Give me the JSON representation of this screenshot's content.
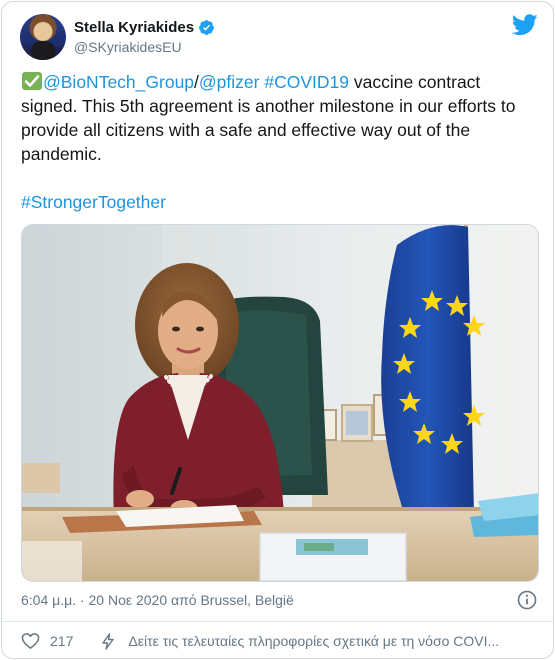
{
  "author": {
    "name": "Stella Kyriakides",
    "handle": "@SKyriakidesEU",
    "verified": true
  },
  "tweet": {
    "check_emoji": "✅",
    "mention_biontech": "@BioNTech_Group",
    "slash": "/",
    "mention_pfizer": "@pfizer",
    "space": " ",
    "hashtag_covid": "#COVID19",
    "body": " vaccine contract signed. This 5th agreement is another milestone in our efforts to provide all citizens with a safe and effective way out of the pandemic.",
    "hashtag_stronger": "#StrongerTogether"
  },
  "meta": {
    "timestamp": "6:04 μ.μ. · 20 Νοε 2020 από Brussel, België"
  },
  "footer": {
    "likes": "217",
    "promo_text": "Δείτε τις τελευταίες πληροφορίες σχετικά με τη νόσο COVI..."
  },
  "colors": {
    "link": "#1b95e0",
    "muted": "#657786",
    "twitter_blue": "#1da1f2",
    "eu_blue": "#1d4fa8",
    "eu_star": "#ffd617",
    "jacket": "#7f1f2c"
  },
  "icons": [
    "verified-badge-icon",
    "twitter-bird-icon",
    "info-icon",
    "heart-icon",
    "lightning-icon",
    "check-mark-icon"
  ]
}
